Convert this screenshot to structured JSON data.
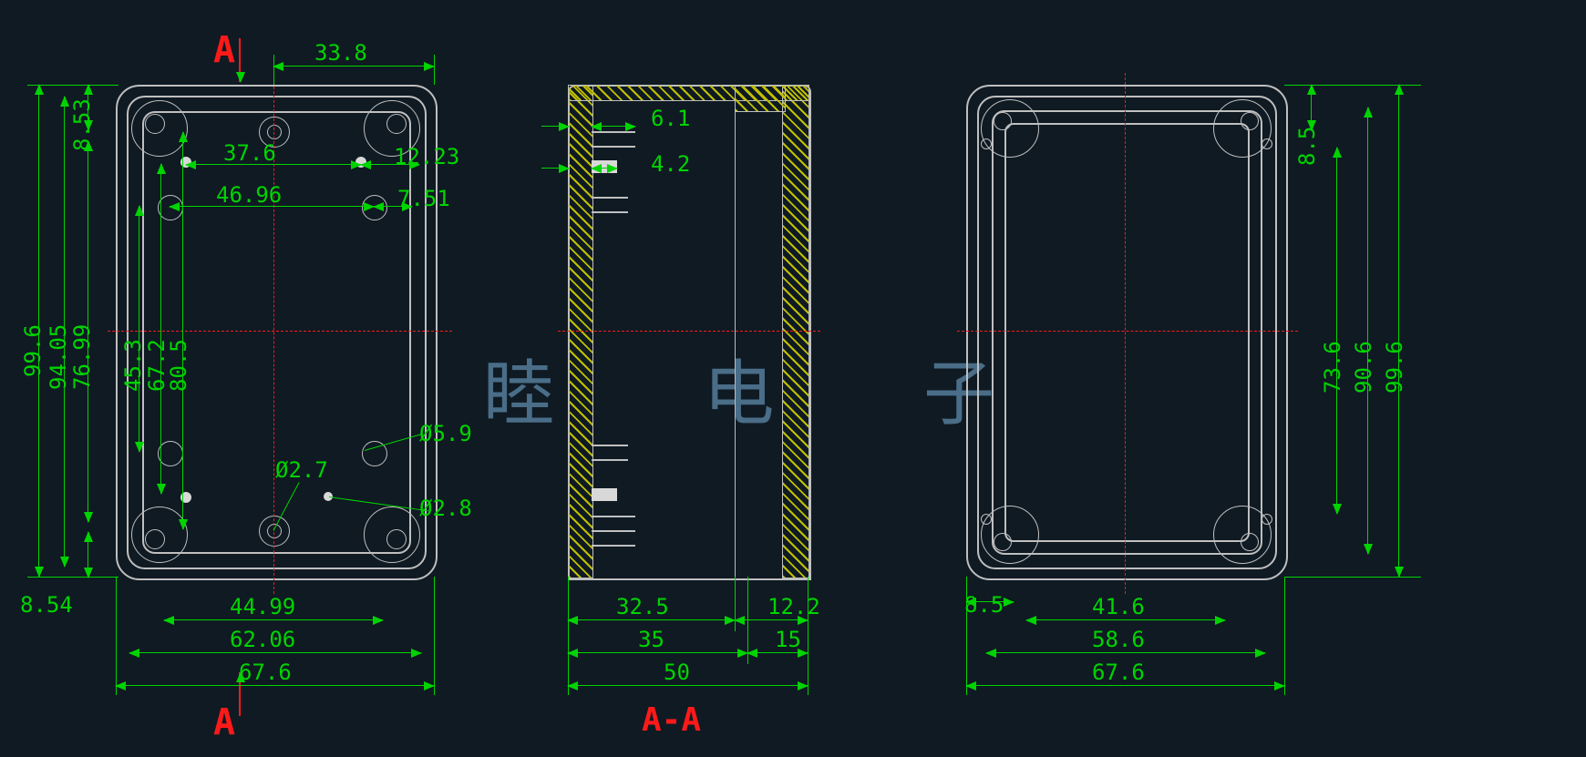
{
  "section_marks": {
    "A_top": "A",
    "A_bottom": "A",
    "section_label": "A-A"
  },
  "watermark": {
    "c1": "睦",
    "c2": "电",
    "c3": "子"
  },
  "front": {
    "dims_top": {
      "w_top_offset": "33.8"
    },
    "dims_left": {
      "h_total": "99.6",
      "h_inner1": "94.05",
      "h_inner2": "76.99",
      "h_inner3": "45.3",
      "h_inner4": "67.2",
      "h_inner5": "80.5",
      "top_off": "8.53",
      "bot_off": "8.54"
    },
    "dims_internal": {
      "x1": "37.6",
      "x1_off": "12.23",
      "x2": "46.96",
      "x2_off": "7.51"
    },
    "dims_dia": {
      "d1": "Ø5.9",
      "d2": "Ø2.7",
      "d3": "Ø2.8"
    },
    "dims_bottom": {
      "b1": "44.99",
      "b2": "62.06",
      "b3": "67.6"
    }
  },
  "section": {
    "dims_internal": {
      "t1": "6.1",
      "t2": "4.2"
    },
    "dims_bottom": {
      "s1": "32.5",
      "s1b": "12.2",
      "s2": "35",
      "s2b": "15",
      "s3": "50"
    }
  },
  "back": {
    "dims_right": {
      "h1": "8.5",
      "h2": "73.6",
      "h3": "90.6",
      "h4": "99.6"
    },
    "dims_bottom": {
      "b0": "8.5",
      "b1": "41.6",
      "b2": "58.6",
      "b3": "67.6"
    }
  }
}
